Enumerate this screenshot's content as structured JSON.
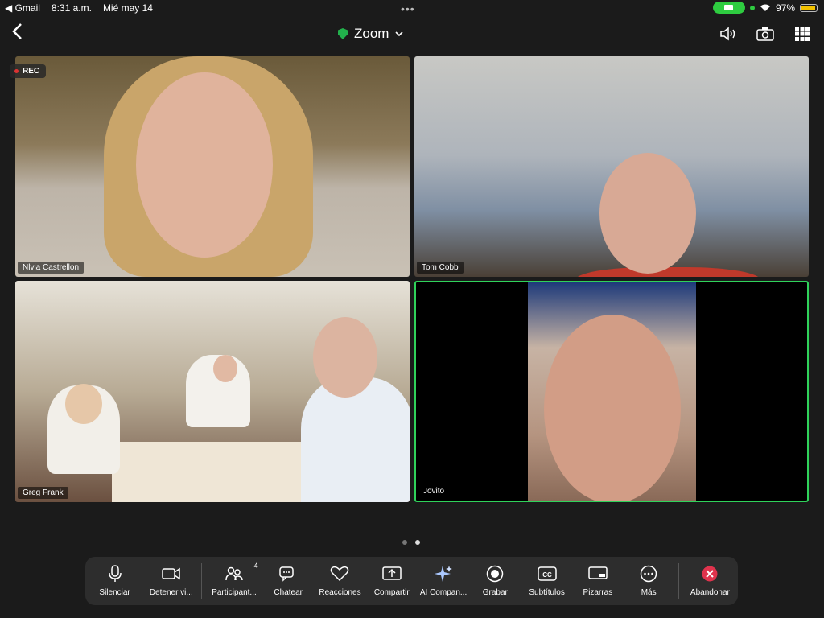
{
  "status_bar": {
    "back_app": "◀ Gmail",
    "time": "8:31 a.m.",
    "date": "Mié may 14",
    "battery": "97%"
  },
  "header": {
    "title": "Zoom"
  },
  "rec_label": "REC",
  "participants": [
    {
      "name": "Nlvia Castrellon"
    },
    {
      "name": "Tom Cobb"
    },
    {
      "name": "Greg Frank"
    },
    {
      "name": "Jovito"
    }
  ],
  "toolbar": {
    "mute": "Silenciar",
    "stop_video": "Detener vi...",
    "participants": "Participant...",
    "participants_count": "4",
    "chat": "Chatear",
    "reactions": "Reacciones",
    "share": "Compartir",
    "ai_companion": "AI Compan...",
    "record": "Grabar",
    "captions": "Subtítulos",
    "whiteboards": "Pizarras",
    "more": "Más",
    "leave": "Abandonar"
  },
  "colors": {
    "active_speaker": "#2fd25a",
    "leave_icon": "#e0334d",
    "camera_indicator": "#2ecc40"
  }
}
